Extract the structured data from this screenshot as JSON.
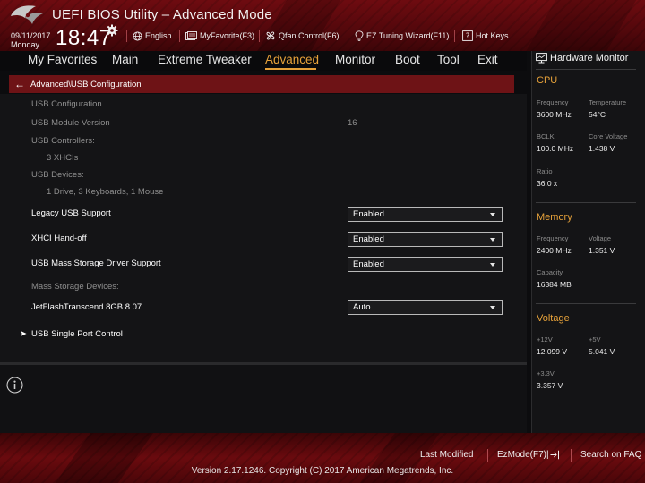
{
  "header": {
    "title": "UEFI BIOS Utility – Advanced Mode",
    "date": "09/11/2017",
    "day": "Monday",
    "time": "18:47",
    "toolbar": [
      {
        "label": "English",
        "icon": "globe-icon"
      },
      {
        "label": "MyFavorite(F3)",
        "icon": "favorite-icon"
      },
      {
        "label": "Qfan Control(F6)",
        "icon": "fan-icon"
      },
      {
        "label": "EZ Tuning Wizard(F11)",
        "icon": "bulb-icon"
      },
      {
        "label": "Hot Keys",
        "icon": "question-icon"
      }
    ]
  },
  "menu": {
    "items": [
      "My Favorites",
      "Main",
      "Extreme Tweaker",
      "Advanced",
      "Monitor",
      "Boot",
      "Tool",
      "Exit"
    ],
    "active": "Advanced"
  },
  "breadcrumb": "Advanced\\USB Configuration",
  "content": {
    "usb_configuration": "USB Configuration",
    "module_version_label": "USB Module Version",
    "module_version_value": "16",
    "controllers_label": "USB Controllers:",
    "controllers_value": "3 XHCIs",
    "devices_label": "USB Devices:",
    "devices_value": "1 Drive, 3 Keyboards, 1 Mouse",
    "legacy_label": "Legacy USB Support",
    "legacy_value": "Enabled",
    "xhci_label": "XHCI Hand-off",
    "xhci_value": "Enabled",
    "mass_storage_label": "USB Mass Storage Driver Support",
    "mass_storage_value": "Enabled",
    "mass_devices_label": "Mass Storage Devices:",
    "jetflash_label": "JetFlashTranscend 8GB 8.07",
    "jetflash_value": "Auto",
    "single_port_label": "USB Single Port Control"
  },
  "hardware_monitor": {
    "title": "Hardware Monitor",
    "cpu": {
      "title": "CPU",
      "frequency_label": "Frequency",
      "frequency": "3600 MHz",
      "temperature_label": "Temperature",
      "temperature": "54°C",
      "bclk_label": "BCLK",
      "bclk": "100.0 MHz",
      "core_voltage_label": "Core Voltage",
      "core_voltage": "1.438 V",
      "ratio_label": "Ratio",
      "ratio": "36.0 x"
    },
    "memory": {
      "title": "Memory",
      "frequency_label": "Frequency",
      "frequency": "2400 MHz",
      "voltage_label": "Voltage",
      "voltage": "1.351 V",
      "capacity_label": "Capacity",
      "capacity": "16384 MB"
    },
    "voltage": {
      "title": "Voltage",
      "v12_label": "+12V",
      "v12": "12.099 V",
      "v5_label": "+5V",
      "v5": "5.041 V",
      "v33_label": "+3.3V",
      "v33": "3.357 V"
    }
  },
  "footer": {
    "last_modified": "Last Modified",
    "ezmode": "EzMode(F7)|",
    "search_faq": "Search on FAQ",
    "copyright": "Version 2.17.1246. Copyright (C) 2017 American Megatrends, Inc."
  },
  "colors": {
    "accent": "#e7a23a",
    "header_red": "#6e0b10",
    "breadcrumb_red": "#6e1316"
  }
}
